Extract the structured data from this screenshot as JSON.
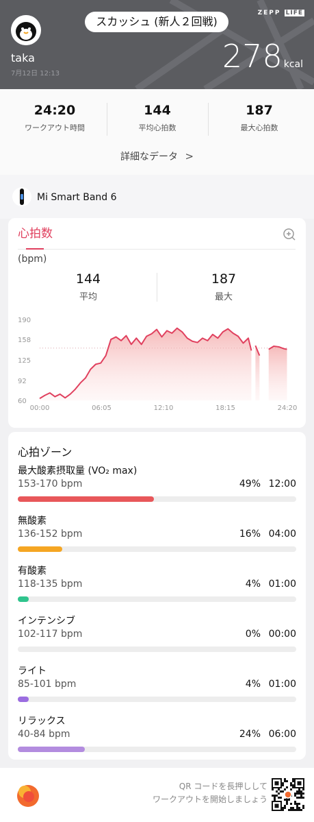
{
  "header": {
    "workout_title": "スカッシュ (新人２回戦)",
    "brand": "ZEPP",
    "brand_life": "LIFE",
    "username": "taka",
    "datetime": "7月12日 12:13",
    "calories": "278",
    "calories_unit": "kcal"
  },
  "summary": {
    "stats": [
      {
        "value": "24:20",
        "label": "ワークアウト時間"
      },
      {
        "value": "144",
        "label": "平均心拍数"
      },
      {
        "value": "187",
        "label": "最大心拍数"
      }
    ],
    "detail_link": "詳細なデータ",
    "detail_chevron": ">"
  },
  "device": {
    "name": "Mi Smart Band 6",
    "icon": "smart-band-icon"
  },
  "heart_rate": {
    "title": "心拍数",
    "unit": "(bpm)",
    "avg_value": "144",
    "avg_label": "平均",
    "max_value": "187",
    "max_label": "最大",
    "accent_color": "#e0405e",
    "zoom_icon": "zoom-in-icon"
  },
  "chart_data": {
    "type": "area",
    "ylim": [
      60,
      190
    ],
    "y_ticks": [
      "190",
      "158",
      "125",
      "92",
      "60"
    ],
    "x_ticks": [
      "00:00",
      "06:05",
      "12:10",
      "18:15",
      "24:20"
    ],
    "avg_line": 144,
    "series": [
      {
        "x": [
          0,
          0.5,
          1,
          1.5,
          2,
          2.5,
          3,
          3.5,
          4,
          4.5,
          5,
          5.5,
          6,
          6.5,
          7,
          7.5,
          8,
          8.5,
          9,
          9.5,
          10,
          10.5,
          11,
          11.5,
          12,
          12.5,
          13,
          13.5,
          14,
          14.5,
          15,
          15.5,
          16,
          16.5,
          17,
          17.5,
          18,
          18.5,
          19,
          19.5,
          20,
          20.5,
          20.8,
          21.2,
          21.6,
          22.5,
          23,
          23.5,
          24,
          24.3
        ],
        "y": [
          63,
          68,
          72,
          66,
          70,
          64,
          70,
          78,
          88,
          96,
          110,
          118,
          120,
          132,
          158,
          162,
          156,
          164,
          150,
          160,
          150,
          163,
          167,
          174,
          162,
          172,
          168,
          176,
          170,
          160,
          155,
          153,
          160,
          156,
          166,
          160,
          170,
          175,
          168,
          163,
          152,
          160,
          140,
          148,
          132,
          142,
          147,
          146,
          143,
          142
        ]
      }
    ],
    "gaps": [
      [
        20.9,
        21.15
      ],
      [
        22.05,
        22.5
      ]
    ],
    "color": "#e0405e"
  },
  "zones": {
    "title": "心拍ゾーン",
    "items": [
      {
        "name": "最大酸素摂取量 (VO₂ max)",
        "range": "153-170 bpm",
        "pct": "49%",
        "time": "12:00",
        "fraction": 0.49,
        "color": "#e8575a"
      },
      {
        "name": "無酸素",
        "range": "136-152 bpm",
        "pct": "16%",
        "time": "04:00",
        "fraction": 0.16,
        "color": "#f5a623"
      },
      {
        "name": "有酸素",
        "range": "118-135 bpm",
        "pct": "4%",
        "time": "01:00",
        "fraction": 0.04,
        "color": "#2fc48d"
      },
      {
        "name": "インテンシブ",
        "range": "102-117 bpm",
        "pct": "0%",
        "time": "00:00",
        "fraction": 0.0,
        "color": "#4a90e2"
      },
      {
        "name": "ライト",
        "range": "85-101 bpm",
        "pct": "4%",
        "time": "01:00",
        "fraction": 0.04,
        "color": "#9b6de0"
      },
      {
        "name": "リラックス",
        "range": "40-84 bpm",
        "pct": "24%",
        "time": "06:00",
        "fraction": 0.24,
        "color": "#b38cdf"
      }
    ]
  },
  "footer": {
    "qr_line1": "QR コードを長押しして",
    "qr_line2": "ワークアウトを開始しましょう"
  }
}
